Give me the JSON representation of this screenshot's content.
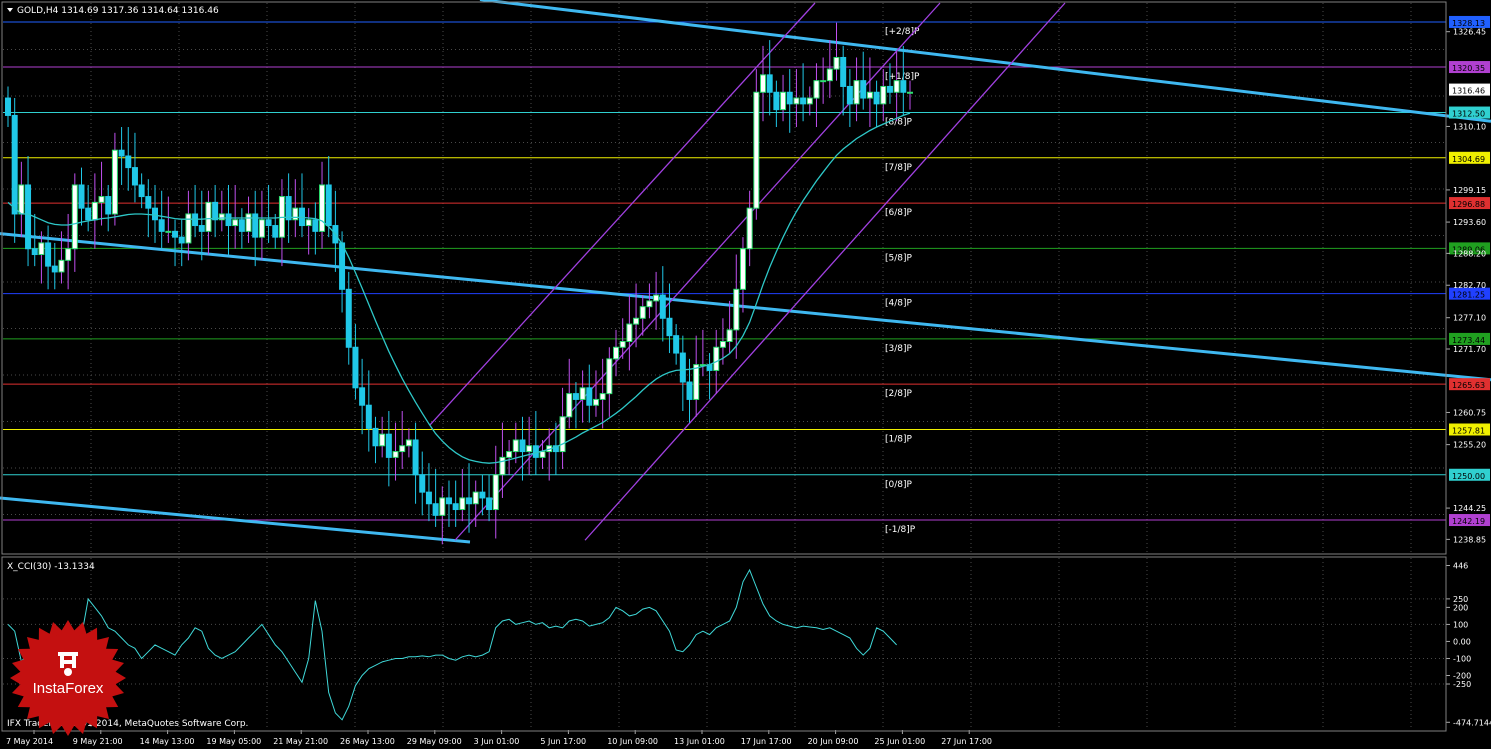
{
  "colors": {
    "grid": "#4a4a4a",
    "candle": "#00e0e0",
    "cyanTrend": "#3fb8f0",
    "channel": "#a040e0",
    "ma": "#2ec8c8",
    "cci": "#3fd8d8"
  },
  "chart_data": {
    "type": "candlestick",
    "main_title": "GOLD,H4  1314.69 1317.36 1314.64 1316.46",
    "cci_title": "X_CCI(30) -13.1334",
    "copyright": "IFX Trader, © 2001-2014, MetaQuotes Software Corp.",
    "price_range": [
      1236.5,
      1331.4
    ],
    "cci_range": [
      -520,
      490
    ],
    "y_ticks": [
      "1326.45",
      "1320.35",
      "1316.46",
      "1312.50",
      "1310.10",
      "1304.69",
      "1299.15",
      "1296.88",
      "1293.60",
      "1289.06",
      "1288.20",
      "1282.70",
      "1281.25",
      "1277.10",
      "1273.44",
      "1271.70",
      "1265.63",
      "1260.75",
      "1257.81",
      "1255.20",
      "1250.00",
      "1244.25",
      "1242.19",
      "1238.85"
    ],
    "x_ticks": [
      "7 May 2014",
      "9 May 21:00",
      "14 May 13:00",
      "19 May 05:00",
      "21 May 21:00",
      "26 May 13:00",
      "29 May 09:00",
      "3 Jun 01:00",
      "5 Jun 17:00",
      "10 Jun 09:00",
      "13 Jun 01:00",
      "17 Jun 17:00",
      "20 Jun 09:00",
      "25 Jun 01:00",
      "27 Jun 17:00"
    ],
    "murrey_levels": [
      {
        "label": "[+2/8]P",
        "price": 1328.13,
        "value_label": "1328.13",
        "color": "#2060ff"
      },
      {
        "label": "[+1/8]P",
        "price": 1320.35,
        "value_label": "1320.35",
        "color": "#b040d0"
      },
      {
        "label": "[8/8]P",
        "price": 1312.5,
        "value_label": "1312.50",
        "color": "#30d0d0"
      },
      {
        "label": "[7/8]P",
        "price": 1304.69,
        "value_label": "1304.69",
        "color": "#f0f000"
      },
      {
        "label": "[6/8]P",
        "price": 1296.88,
        "value_label": "1296.88",
        "color": "#e03030"
      },
      {
        "label": "[5/8]P",
        "price": 1289.06,
        "value_label": "1289.06",
        "color": "#20a020"
      },
      {
        "label": "[4/8]P",
        "price": 1281.25,
        "value_label": "1281.25",
        "color": "#2040ff"
      },
      {
        "label": "[3/8]P",
        "price": 1273.44,
        "value_label": "1273.44",
        "color": "#20a020"
      },
      {
        "label": "[2/8]P",
        "price": 1265.63,
        "value_label": "1265.63",
        "color": "#e03030"
      },
      {
        "label": "[1/8]P",
        "price": 1257.81,
        "value_label": "1257.81",
        "color": "#f0f000"
      },
      {
        "label": "[0/8]P",
        "price": 1250.0,
        "value_label": "1250.00",
        "color": "#30d0d0"
      },
      {
        "label": "[-1/8]P",
        "price": 1242.19,
        "value_label": "1242.19",
        "color": "#b040d0"
      }
    ],
    "current_price": "1316.46",
    "cci_ticks": [
      "446",
      "250",
      "200",
      "100",
      "0.00",
      "-100",
      "-200",
      "-250",
      "-474.7144"
    ],
    "cci_tick_values": [
      446,
      250,
      200,
      100,
      0,
      -100,
      -200,
      -250,
      -474.7144
    ],
    "closes": [
      1312,
      1295,
      1300,
      1289,
      1288,
      1290,
      1286,
      1285,
      1287,
      1289,
      1300,
      1296,
      1294,
      1297,
      1298,
      1295,
      1306,
      1305,
      1303,
      1300,
      1298,
      1296,
      1294,
      1292,
      1292,
      1291,
      1290,
      1295,
      1293,
      1292,
      1297,
      1294,
      1295,
      1293,
      1294,
      1292,
      1295,
      1291,
      1294,
      1293,
      1291,
      1298,
      1294,
      1296,
      1293,
      1294,
      1292,
      1300,
      1293,
      1290,
      1282,
      1272,
      1265,
      1262,
      1258,
      1255,
      1257,
      1253,
      1254,
      1255,
      1256,
      1250,
      1247,
      1245,
      1243,
      1246,
      1245,
      1244,
      1246,
      1245,
      1247,
      1246,
      1244,
      1250,
      1253,
      1254,
      1256,
      1254,
      1255,
      1253,
      1254,
      1255,
      1254,
      1260,
      1264,
      1263,
      1265,
      1262,
      1263,
      1264,
      1270,
      1272,
      1273,
      1276,
      1277,
      1279,
      1280,
      1281,
      1277,
      1274,
      1271,
      1266,
      1263,
      1269,
      1269,
      1268,
      1272,
      1273,
      1275,
      1282,
      1289,
      1296,
      1316,
      1319,
      1316,
      1313,
      1316,
      1314,
      1315,
      1314,
      1315,
      1318,
      1318,
      1320,
      1322,
      1317,
      1314,
      1318,
      1315,
      1316,
      1314,
      1317,
      1316,
      1318,
      1316,
      1316
    ],
    "ma_values": [
      1297.0,
      1296.0,
      1295.0,
      1295.0,
      1294.5,
      1294.0,
      1293.5,
      1293.2,
      1293.1,
      1293.1,
      1293.3,
      1293.6,
      1293.8,
      1294.0,
      1294.2,
      1294.3,
      1294.5,
      1294.7,
      1294.9,
      1295.0,
      1295.0,
      1294.9,
      1294.8,
      1294.6,
      1294.4,
      1294.2,
      1294.1,
      1294.1,
      1294.1,
      1294.1,
      1294.2,
      1294.2,
      1294.3,
      1294.3,
      1294.3,
      1294.3,
      1294.3,
      1294.3,
      1294.3,
      1294.3,
      1294.3,
      1294.4,
      1294.4,
      1294.4,
      1294.4,
      1294.3,
      1294.2,
      1293.8,
      1292.8,
      1291.5,
      1289.8,
      1287.5,
      1284.9,
      1282.2,
      1279.4,
      1276.6,
      1273.9,
      1271.3,
      1268.9,
      1266.6,
      1264.5,
      1262.5,
      1260.6,
      1258.8,
      1257.1,
      1255.8,
      1254.7,
      1253.8,
      1253.1,
      1252.6,
      1252.3,
      1252.1,
      1252.0,
      1252.1,
      1252.3,
      1252.6,
      1252.9,
      1253.2,
      1253.5,
      1253.8,
      1254.1,
      1254.4,
      1254.8,
      1255.3,
      1255.9,
      1256.5,
      1257.2,
      1257.8,
      1258.4,
      1259.0,
      1259.8,
      1260.6,
      1261.5,
      1262.5,
      1263.5,
      1264.6,
      1265.6,
      1266.5,
      1267.2,
      1267.7,
      1268.0,
      1268.1,
      1268.2,
      1268.4,
      1268.7,
      1269.0,
      1269.5,
      1270.1,
      1270.9,
      1272.2,
      1274.0,
      1276.3,
      1279.5,
      1282.8,
      1285.8,
      1288.5,
      1291.0,
      1293.3,
      1295.4,
      1297.3,
      1299.0,
      1300.7,
      1302.2,
      1303.7,
      1305.1,
      1306.2,
      1307.1,
      1308.0,
      1308.7,
      1309.4,
      1310.0,
      1310.5,
      1311.0,
      1311.5,
      1312.0,
      1312.4
    ],
    "cci_values": [
      100,
      60,
      -120,
      -60,
      -80,
      -100,
      -60,
      -40,
      -80,
      -60,
      -20,
      30,
      250,
      200,
      150,
      80,
      60,
      20,
      -20,
      -40,
      -100,
      -60,
      -20,
      -40,
      -60,
      -80,
      -20,
      20,
      80,
      60,
      -40,
      -80,
      -100,
      -80,
      -60,
      -20,
      20,
      60,
      100,
      40,
      -20,
      -60,
      -120,
      -180,
      -240,
      -100,
      240,
      60,
      -300,
      -420,
      -460,
      -380,
      -260,
      -200,
      -160,
      -140,
      -120,
      -110,
      -100,
      -100,
      -90,
      -90,
      -85,
      -90,
      -80,
      -80,
      -100,
      -110,
      -90,
      -80,
      -90,
      -80,
      -60,
      80,
      120,
      130,
      100,
      110,
      120,
      100,
      110,
      80,
      90,
      80,
      120,
      130,
      120,
      90,
      100,
      110,
      140,
      200,
      180,
      150,
      160,
      190,
      200,
      180,
      120,
      60,
      -50,
      -60,
      -20,
      40,
      60,
      40,
      80,
      100,
      120,
      200,
      350,
      420,
      320,
      220,
      150,
      120,
      100,
      90,
      80,
      90,
      85,
      80,
      70,
      80,
      60,
      40,
      20,
      -40,
      -80,
      -40,
      80,
      60,
      20,
      -20
    ],
    "channel": {
      "lower_start": [
        1250,
        1246
      ],
      "lower_end": [
        1660,
        1350
      ],
      "mid_offset": 20,
      "upper_offset": 42
    },
    "cyan_trendlines": [
      {
        "from": [
          480,
          1332
        ],
        "to": [
          1491,
          1311
        ]
      },
      {
        "from": [
          0,
          1291.6
        ],
        "to": [
          1491,
          1266.4
        ]
      },
      {
        "from": [
          0,
          1246.0
        ],
        "to": [
          470,
          1238.4
        ]
      }
    ]
  }
}
